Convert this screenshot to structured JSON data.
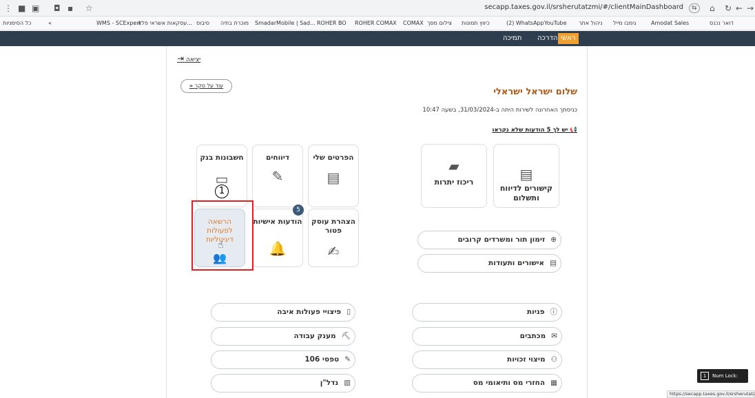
{
  "browser": {
    "url": "secapp.taxes.gov.il/srsherutatzmi/#/clientMainDashboard",
    "status_url": "https://secapp.taxes.gov.il/srsherutatzmi",
    "bookmarks": [
      "כל הסימניות",
      "WMS - SCExpert",
      "עסקאות אשראי פלא...",
      "סיבוס",
      "מוכרת בתיה",
      "SmadarMobile | Sad...",
      "ROHER BO",
      "ROHER COMAX",
      "COMAX",
      "צילום מסך",
      "כיווץ תמונות",
      "(2) WhatsApp",
      "YouTube",
      "ניהול אתר",
      "גימבו מייל",
      "Amodat Sales",
      "דואר נכנס"
    ]
  },
  "nav": {
    "home": "ראשי",
    "guide": "הדרכה",
    "support": "תמיכה"
  },
  "header": {
    "logout": "יציאה",
    "about": "עוד על סקר",
    "greeting": "שלום ישראל ישראלי",
    "last_visit": "כניסתך האחרונה לשירות היתה ב-31/03/2024, בשעה 10:47",
    "messages_link": "יש לך 5 הודעות שלא נקראו"
  },
  "tiles": {
    "my_details": "הפרטים שלי",
    "reports": "דיווחים",
    "bank_accounts": "חשבונות בנק",
    "exempt_dealer": "הצהרת עוסק פטור",
    "personal_messages": "הודעות אישיות",
    "personal_messages_count": "5",
    "digital_auth": "הרשאה לפעולות דיגיטליות",
    "balance_summary": "ריכוז יתרות",
    "report_links": "קישורים לדיווח ותשלום",
    "step_marker": "1"
  },
  "pills": {
    "appointments": "זימון תור ומשרדים קרובים",
    "certificates": "אישורים ותעודות",
    "inquiries": "פניות",
    "letters": "מכתבים",
    "rights": "מיצוי זכויות",
    "refunds": "החזרי מס ותיאומי מס",
    "compensation": "פיצויי פעולות איבה",
    "work_grant": "מענק עבודה",
    "form_106": "טפסי 106",
    "real_estate": "נדל\"ן"
  },
  "system": {
    "numlock": "Num Lock: OFF"
  }
}
